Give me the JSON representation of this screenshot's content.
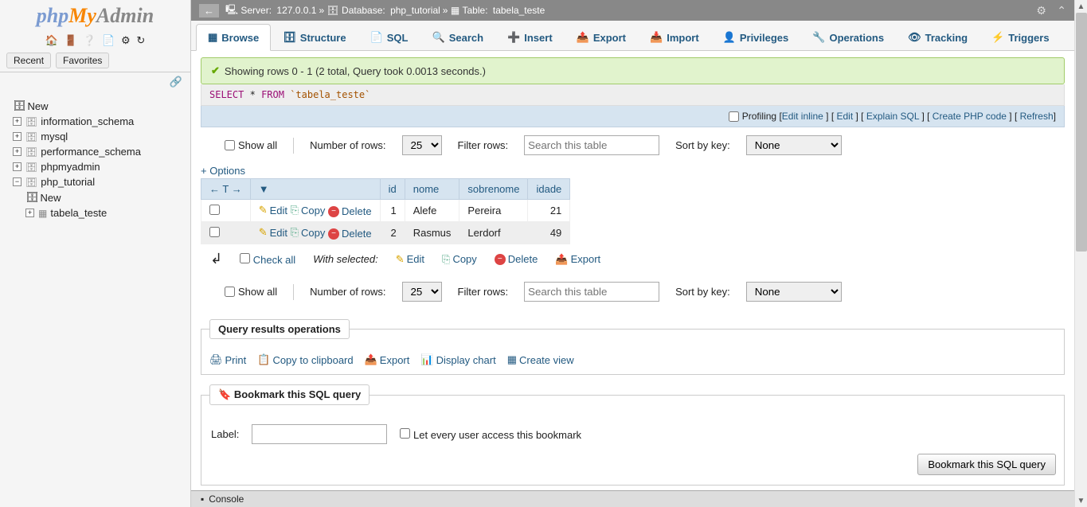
{
  "logo": {
    "php": "php",
    "my": "My",
    "admin": "Admin"
  },
  "sidebar_tabs": {
    "recent": "Recent",
    "favorites": "Favorites"
  },
  "tree": {
    "new": "New",
    "databases": [
      "information_schema",
      "mysql",
      "performance_schema",
      "phpmyadmin",
      "php_tutorial"
    ],
    "expanded_db_new": "New",
    "expanded_table": "tabela_teste"
  },
  "breadcrumb": {
    "server_label": "Server:",
    "server": "127.0.0.1",
    "db_label": "Database:",
    "db": "php_tutorial",
    "table_label": "Table:",
    "table": "tabela_teste"
  },
  "tabs": [
    "Browse",
    "Structure",
    "SQL",
    "Search",
    "Insert",
    "Export",
    "Import",
    "Privileges",
    "Operations",
    "Tracking",
    "Triggers"
  ],
  "success_msg": "Showing rows 0 - 1 (2 total, Query took 0.0013 seconds.)",
  "sql_query": {
    "select": "SELECT",
    "star": "*",
    "from": "FROM",
    "table": "`tabela_teste`"
  },
  "query_actions": {
    "profiling": "Profiling",
    "edit_inline": "Edit inline",
    "edit": "Edit",
    "explain": "Explain SQL",
    "php": "Create PHP code",
    "refresh": "Refresh"
  },
  "controls": {
    "show_all": "Show all",
    "num_rows": "Number of rows:",
    "num_rows_value": "25",
    "filter_rows": "Filter rows:",
    "filter_placeholder": "Search this table",
    "sort_key": "Sort by key:",
    "sort_value": "None"
  },
  "options_link": "+ Options",
  "columns": [
    "id",
    "nome",
    "sobrenome",
    "idade"
  ],
  "row_actions": {
    "edit": "Edit",
    "copy": "Copy",
    "delete": "Delete"
  },
  "rows": [
    {
      "id": "1",
      "nome": "Alefe",
      "sobrenome": "Pereira",
      "idade": "21"
    },
    {
      "id": "2",
      "nome": "Rasmus",
      "sobrenome": "Lerdorf",
      "idade": "49"
    }
  ],
  "bulk": {
    "check_all": "Check all",
    "with_selected": "With selected:",
    "edit": "Edit",
    "copy": "Copy",
    "delete": "Delete",
    "export": "Export"
  },
  "ops": {
    "legend": "Query results operations",
    "print": "Print",
    "clipboard": "Copy to clipboard",
    "export": "Export",
    "chart": "Display chart",
    "view": "Create view"
  },
  "bookmark": {
    "legend": "Bookmark this SQL query",
    "label": "Label:",
    "let_all": "Let every user access this bookmark",
    "button": "Bookmark this SQL query"
  },
  "console": "Console"
}
